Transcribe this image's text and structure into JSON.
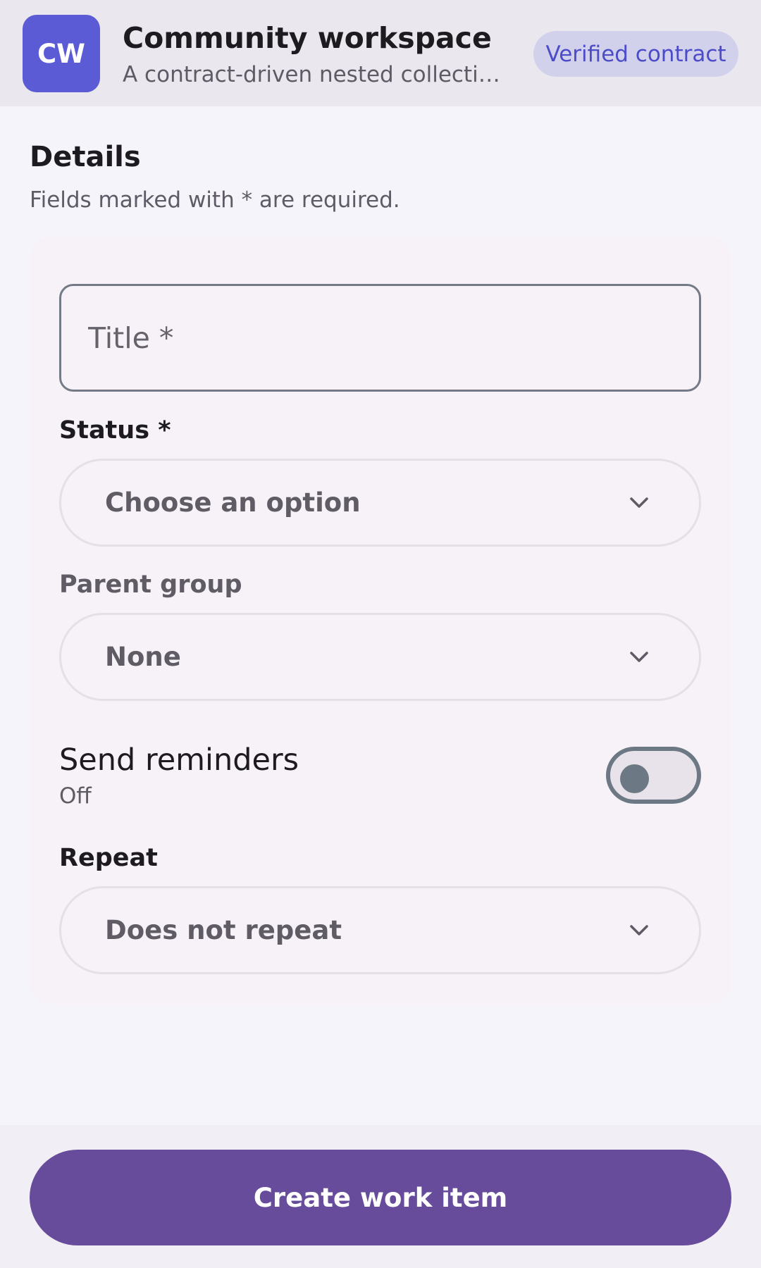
{
  "header": {
    "avatar_initials": "CW",
    "title": "Community workspace",
    "subtitle": "A contract-driven nested collection …",
    "badge": "Verified contract"
  },
  "section": {
    "title": "Details",
    "hint": "Fields marked with * are required."
  },
  "form": {
    "title_field": {
      "placeholder": "Title *",
      "value": ""
    },
    "status": {
      "label": "Status *",
      "selected": "Choose an option",
      "icon": "chevron-down-icon"
    },
    "parent_group": {
      "label": "Parent group",
      "selected": "None",
      "icon": "chevron-down-icon"
    },
    "reminders": {
      "label": "Send reminders",
      "state_text": "Off",
      "enabled": false
    },
    "repeat": {
      "label": "Repeat",
      "selected": "Does not repeat",
      "icon": "chevron-down-icon"
    }
  },
  "footer": {
    "submit_label": "Create work item"
  },
  "colors": {
    "accent": "#674c9c",
    "avatar": "#5b5bd6",
    "badge_bg": "#d2d1ec",
    "badge_text": "#4c4cc8"
  }
}
